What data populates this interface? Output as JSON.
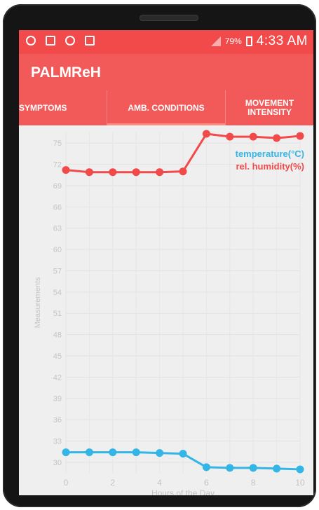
{
  "status_bar": {
    "icons": [
      "voicemail-icon",
      "download-icon",
      "wifi-question-icon",
      "notification-icon"
    ],
    "battery_percent": "79%",
    "time": "4:33 AM"
  },
  "app": {
    "title": "PALMReH"
  },
  "tabs": [
    {
      "label": "SYMPTOMS"
    },
    {
      "label": "AMB. CONDITIONS",
      "selected": true
    },
    {
      "label": "MOVEMENT INTENSITY"
    }
  ],
  "colors": {
    "status_bar": "#f24a4a",
    "app_bar": "#f25a5a",
    "temperature": "#33b5e5",
    "humidity": "#f24a4a"
  },
  "chart_data": {
    "type": "line",
    "xlabel": "Hours of the Day",
    "ylabel": "Measurements",
    "x": [
      0,
      1,
      2,
      3,
      4,
      5,
      6,
      7,
      8,
      9,
      10
    ],
    "x_ticks": [
      0,
      2,
      4,
      6,
      8,
      10
    ],
    "y_ticks": [
      30,
      33,
      36,
      39,
      42,
      45,
      48,
      51,
      54,
      57,
      60,
      63,
      66,
      69,
      72,
      75
    ],
    "ylim": [
      28.5,
      76.5
    ],
    "grid": true,
    "legend_position": "top-right",
    "series": [
      {
        "name": "temperature(°C)",
        "color": "#33b5e5",
        "values": [
          31.4,
          31.4,
          31.4,
          31.4,
          31.3,
          31.2,
          29.3,
          29.2,
          29.2,
          29.1,
          29.0
        ]
      },
      {
        "name": "rel. humidity(%)",
        "color": "#f24a4a",
        "values": [
          71.2,
          70.9,
          70.9,
          70.9,
          70.9,
          71.0,
          76.3,
          75.9,
          75.9,
          75.7,
          76.0
        ]
      }
    ]
  }
}
